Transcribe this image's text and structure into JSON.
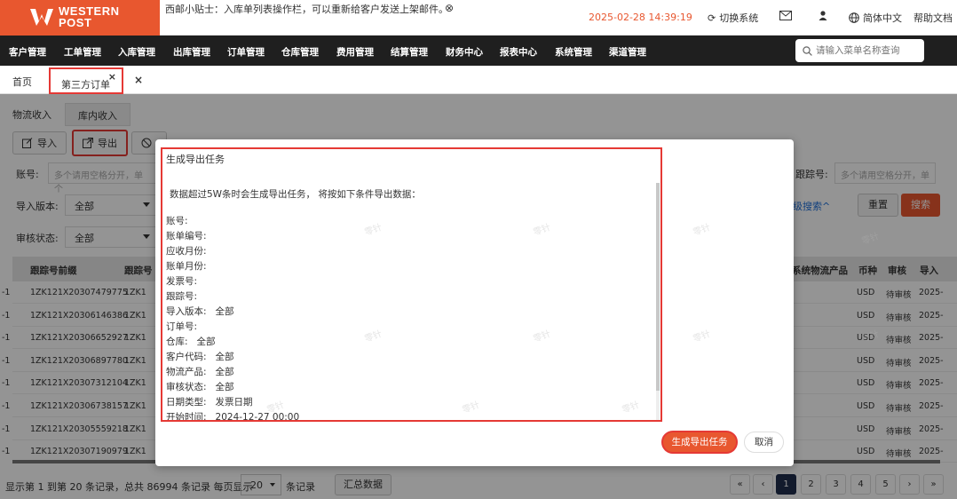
{
  "header": {
    "logo_line1": "WESTERN",
    "logo_line2": "POST",
    "tip": "西邮小贴士：入库单列表操作栏，可以重新给客户发送上架邮件。",
    "tip_close": "⊗",
    "datetime": "2025-02-28 14:39:19",
    "switch_system": "切换系统",
    "language": "简体中文",
    "help": "帮助文档"
  },
  "nav": {
    "items": [
      "客户管理",
      "工单管理",
      "入库管理",
      "出库管理",
      "订单管理",
      "仓库管理",
      "费用管理",
      "结算管理",
      "财务中心",
      "报表中心",
      "系统管理",
      "渠道管理"
    ],
    "search_placeholder": "请输入菜单名称查询"
  },
  "tabs": {
    "home": "首页",
    "active": "第三方订单",
    "active_close": "×",
    "close_all": "×"
  },
  "page": {
    "subtabs": [
      "物流收入",
      "库内收入"
    ],
    "import_btn": "导入",
    "export_btn": "导出",
    "filters": {
      "account_label": "账号:",
      "account_placeholder": "多个请用空格分开，单个",
      "tracking_label": "跟踪号:",
      "tracking_placeholder": "多个请用空格分开，单",
      "import_version_label": "导入版本:",
      "import_version_value": "全部",
      "audit_label": "审核状态:",
      "audit_value": "全部"
    },
    "advanced_search": "级搜索^",
    "reset": "重置",
    "search": "搜索",
    "columns_left": [
      "跟踪号前缀",
      "跟踪号"
    ],
    "columns_right": [
      "系统物流产品",
      "币种",
      "审核",
      "导入"
    ],
    "rows": [
      {
        "prefix": "-1",
        "tracking": "1ZK121X20307479775",
        "tracking2": "1ZK1",
        "currency": "USD",
        "audit": "待审核",
        "import": "2025-"
      },
      {
        "prefix": "-1",
        "tracking": "1ZK121X20306146386",
        "tracking2": "1ZK1",
        "currency": "USD",
        "audit": "待审核",
        "import": "2025-"
      },
      {
        "prefix": "-1",
        "tracking": "1ZK121X20306652927",
        "tracking2": "1ZK1",
        "currency": "USD",
        "audit": "待审核",
        "import": "2025-"
      },
      {
        "prefix": "-1",
        "tracking": "1ZK121X20306897780",
        "tracking2": "1ZK1",
        "currency": "USD",
        "audit": "待审核",
        "import": "2025-"
      },
      {
        "prefix": "-1",
        "tracking": "1ZK121X20307312104",
        "tracking2": "1ZK1",
        "currency": "USD",
        "audit": "待审核",
        "import": "2025-"
      },
      {
        "prefix": "-1",
        "tracking": "1ZK121X20306738157",
        "tracking2": "1ZK1",
        "currency": "USD",
        "audit": "待审核",
        "import": "2025-"
      },
      {
        "prefix": "-1",
        "tracking": "1ZK121X20305559218",
        "tracking2": "1ZK1",
        "currency": "USD",
        "audit": "待审核",
        "import": "2025-"
      },
      {
        "prefix": "-1",
        "tracking": "1ZK121X20307190979",
        "tracking2": "1ZK1",
        "currency": "USD",
        "audit": "待审核",
        "import": "2025-"
      }
    ],
    "footer": {
      "summary_text": "显示第 1 到第 20 条记录，总共 86994 条记录 每页显示",
      "page_size": "20",
      "records_suffix": "条记录",
      "summary_btn": "汇总数据",
      "pages": [
        "«",
        "‹",
        "1",
        "2",
        "3",
        "4",
        "5",
        "›",
        "»"
      ],
      "current_page": "1"
    }
  },
  "modal": {
    "title": "生成导出任务",
    "note": "数据超过5W条时会生成导出任务， 将按如下条件导出数据：",
    "fields": [
      {
        "label": "账号:",
        "value": ""
      },
      {
        "label": "账单编号:",
        "value": ""
      },
      {
        "label": "应收月份:",
        "value": ""
      },
      {
        "label": "账单月份:",
        "value": ""
      },
      {
        "label": "发票号:",
        "value": ""
      },
      {
        "label": "跟踪号:",
        "value": ""
      },
      {
        "label": "导入版本:",
        "value": "全部"
      },
      {
        "label": "订单号:",
        "value": ""
      },
      {
        "label": "仓库:",
        "value": "全部"
      },
      {
        "label": "客户代码:",
        "value": "全部"
      },
      {
        "label": "物流产品:",
        "value": "全部"
      },
      {
        "label": "审核状态:",
        "value": "全部"
      },
      {
        "label": "日期类型:",
        "value": "发票日期"
      },
      {
        "label": "开始时间:",
        "value": "2024-12-27 00:00"
      }
    ],
    "generate_btn": "生成导出任务",
    "cancel_btn": "取消"
  },
  "watermark": "零针"
}
